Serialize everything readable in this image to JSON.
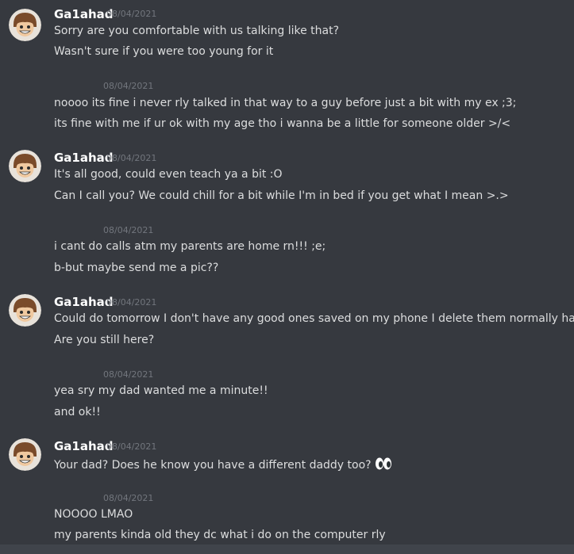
{
  "conversation": {
    "messages": [
      {
        "author": "Ga1ahad",
        "timestamp": "08/04/2021",
        "lines": [
          "Sorry are you comfortable with us talking like that?",
          "Wasn't sure if you were too young for it"
        ]
      },
      {
        "author": "",
        "timestamp": "08/04/2021",
        "lines": [
          "noooo its fine i never rly talked in that way to a guy before just a bit with my ex ;3;",
          "its fine with me if ur ok with my age tho i wanna be a little for someone older >/<"
        ]
      },
      {
        "author": "Ga1ahad",
        "timestamp": "08/04/2021",
        "lines": [
          "It's all good, could even teach ya a bit :O",
          "Can I call you? We could chill for a bit while I'm in bed if you get what I mean >.>"
        ]
      },
      {
        "author": "",
        "timestamp": "08/04/2021",
        "lines": [
          "i cant do calls atm my parents are home rn!!! ;e;",
          "b-but maybe send me a pic??"
        ]
      },
      {
        "author": "Ga1ahad",
        "timestamp": "08/04/2021",
        "lines": [
          "Could do tomorrow I don't have any good ones saved on my phone I delete them normally haha",
          "Are you still here?"
        ]
      },
      {
        "author": "",
        "timestamp": "08/04/2021",
        "lines": [
          "yea sry my dad wanted me a minute!!",
          "and ok!!"
        ]
      },
      {
        "author": "Ga1ahad",
        "timestamp": "08/04/2021",
        "lines": [
          "Your dad? Does he know you have a different daddy too?"
        ],
        "emoji": "eyes-emoji"
      },
      {
        "author": "",
        "timestamp": "08/04/2021",
        "lines": [
          "NOOOO LMAO",
          "my parents kinda old they dc what i do on the computer rly"
        ]
      }
    ]
  },
  "colors": {
    "background": "#36393f",
    "username": "#ffffff",
    "message_text": "#dcddde",
    "timestamp": "#72767d"
  }
}
